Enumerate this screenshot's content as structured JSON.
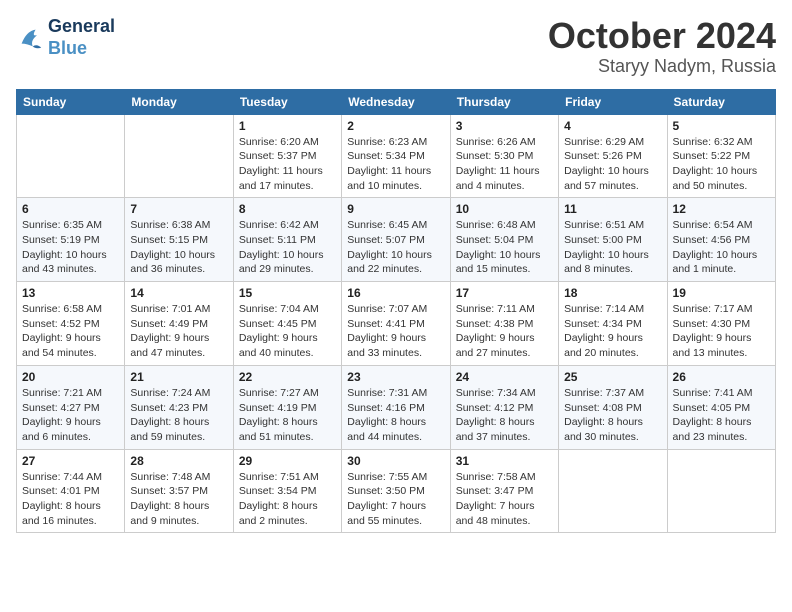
{
  "header": {
    "logo_line1": "General",
    "logo_line2": "Blue",
    "month": "October 2024",
    "location": "Staryy Nadym, Russia"
  },
  "weekdays": [
    "Sunday",
    "Monday",
    "Tuesday",
    "Wednesday",
    "Thursday",
    "Friday",
    "Saturday"
  ],
  "weeks": [
    [
      {
        "day": "",
        "info": ""
      },
      {
        "day": "",
        "info": ""
      },
      {
        "day": "1",
        "info": "Sunrise: 6:20 AM\nSunset: 5:37 PM\nDaylight: 11 hours\nand 17 minutes."
      },
      {
        "day": "2",
        "info": "Sunrise: 6:23 AM\nSunset: 5:34 PM\nDaylight: 11 hours\nand 10 minutes."
      },
      {
        "day": "3",
        "info": "Sunrise: 6:26 AM\nSunset: 5:30 PM\nDaylight: 11 hours\nand 4 minutes."
      },
      {
        "day": "4",
        "info": "Sunrise: 6:29 AM\nSunset: 5:26 PM\nDaylight: 10 hours\nand 57 minutes."
      },
      {
        "day": "5",
        "info": "Sunrise: 6:32 AM\nSunset: 5:22 PM\nDaylight: 10 hours\nand 50 minutes."
      }
    ],
    [
      {
        "day": "6",
        "info": "Sunrise: 6:35 AM\nSunset: 5:19 PM\nDaylight: 10 hours\nand 43 minutes."
      },
      {
        "day": "7",
        "info": "Sunrise: 6:38 AM\nSunset: 5:15 PM\nDaylight: 10 hours\nand 36 minutes."
      },
      {
        "day": "8",
        "info": "Sunrise: 6:42 AM\nSunset: 5:11 PM\nDaylight: 10 hours\nand 29 minutes."
      },
      {
        "day": "9",
        "info": "Sunrise: 6:45 AM\nSunset: 5:07 PM\nDaylight: 10 hours\nand 22 minutes."
      },
      {
        "day": "10",
        "info": "Sunrise: 6:48 AM\nSunset: 5:04 PM\nDaylight: 10 hours\nand 15 minutes."
      },
      {
        "day": "11",
        "info": "Sunrise: 6:51 AM\nSunset: 5:00 PM\nDaylight: 10 hours\nand 8 minutes."
      },
      {
        "day": "12",
        "info": "Sunrise: 6:54 AM\nSunset: 4:56 PM\nDaylight: 10 hours\nand 1 minute."
      }
    ],
    [
      {
        "day": "13",
        "info": "Sunrise: 6:58 AM\nSunset: 4:52 PM\nDaylight: 9 hours\nand 54 minutes."
      },
      {
        "day": "14",
        "info": "Sunrise: 7:01 AM\nSunset: 4:49 PM\nDaylight: 9 hours\nand 47 minutes."
      },
      {
        "day": "15",
        "info": "Sunrise: 7:04 AM\nSunset: 4:45 PM\nDaylight: 9 hours\nand 40 minutes."
      },
      {
        "day": "16",
        "info": "Sunrise: 7:07 AM\nSunset: 4:41 PM\nDaylight: 9 hours\nand 33 minutes."
      },
      {
        "day": "17",
        "info": "Sunrise: 7:11 AM\nSunset: 4:38 PM\nDaylight: 9 hours\nand 27 minutes."
      },
      {
        "day": "18",
        "info": "Sunrise: 7:14 AM\nSunset: 4:34 PM\nDaylight: 9 hours\nand 20 minutes."
      },
      {
        "day": "19",
        "info": "Sunrise: 7:17 AM\nSunset: 4:30 PM\nDaylight: 9 hours\nand 13 minutes."
      }
    ],
    [
      {
        "day": "20",
        "info": "Sunrise: 7:21 AM\nSunset: 4:27 PM\nDaylight: 9 hours\nand 6 minutes."
      },
      {
        "day": "21",
        "info": "Sunrise: 7:24 AM\nSunset: 4:23 PM\nDaylight: 8 hours\nand 59 minutes."
      },
      {
        "day": "22",
        "info": "Sunrise: 7:27 AM\nSunset: 4:19 PM\nDaylight: 8 hours\nand 51 minutes."
      },
      {
        "day": "23",
        "info": "Sunrise: 7:31 AM\nSunset: 4:16 PM\nDaylight: 8 hours\nand 44 minutes."
      },
      {
        "day": "24",
        "info": "Sunrise: 7:34 AM\nSunset: 4:12 PM\nDaylight: 8 hours\nand 37 minutes."
      },
      {
        "day": "25",
        "info": "Sunrise: 7:37 AM\nSunset: 4:08 PM\nDaylight: 8 hours\nand 30 minutes."
      },
      {
        "day": "26",
        "info": "Sunrise: 7:41 AM\nSunset: 4:05 PM\nDaylight: 8 hours\nand 23 minutes."
      }
    ],
    [
      {
        "day": "27",
        "info": "Sunrise: 7:44 AM\nSunset: 4:01 PM\nDaylight: 8 hours\nand 16 minutes."
      },
      {
        "day": "28",
        "info": "Sunrise: 7:48 AM\nSunset: 3:57 PM\nDaylight: 8 hours\nand 9 minutes."
      },
      {
        "day": "29",
        "info": "Sunrise: 7:51 AM\nSunset: 3:54 PM\nDaylight: 8 hours\nand 2 minutes."
      },
      {
        "day": "30",
        "info": "Sunrise: 7:55 AM\nSunset: 3:50 PM\nDaylight: 7 hours\nand 55 minutes."
      },
      {
        "day": "31",
        "info": "Sunrise: 7:58 AM\nSunset: 3:47 PM\nDaylight: 7 hours\nand 48 minutes."
      },
      {
        "day": "",
        "info": ""
      },
      {
        "day": "",
        "info": ""
      }
    ]
  ]
}
